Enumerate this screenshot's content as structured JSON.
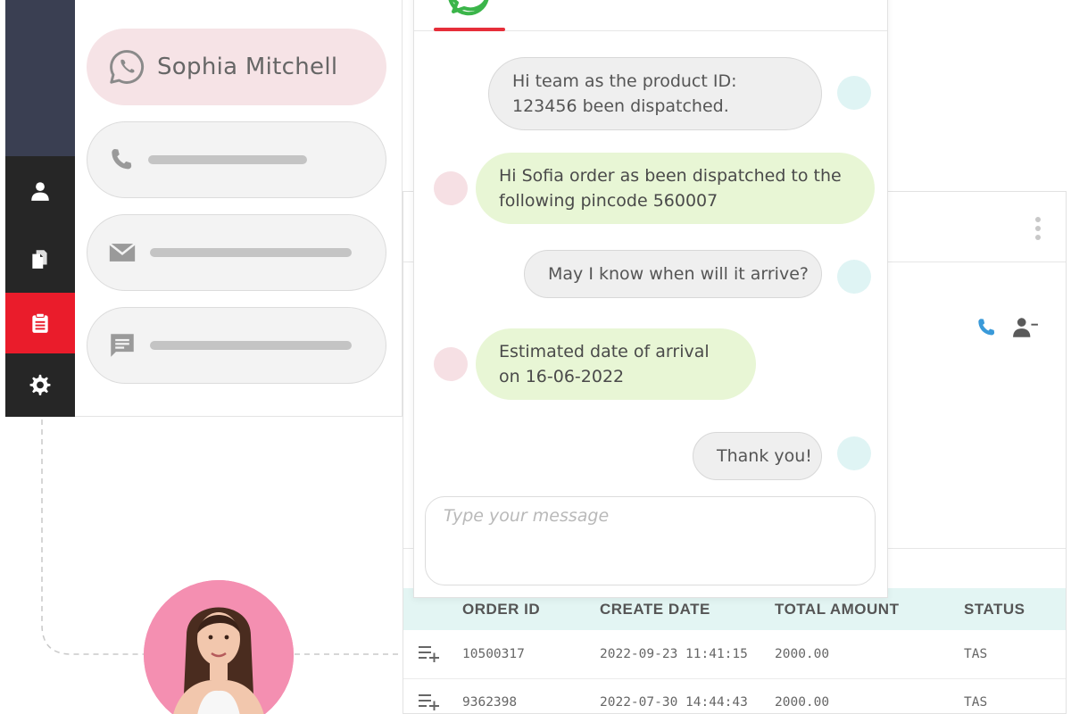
{
  "sidebar": {
    "items": [
      {
        "icon": "user-icon"
      },
      {
        "icon": "documents-icon"
      },
      {
        "icon": "clipboard-icon",
        "active": true
      },
      {
        "icon": "gear-icon"
      }
    ],
    "active_color": "#ea1c2b"
  },
  "contact": {
    "name": "Sophia Mitchell",
    "name_icon": "whatsapp-icon",
    "fields": [
      {
        "icon": "phone-icon"
      },
      {
        "icon": "mail-icon"
      },
      {
        "icon": "message-icon"
      }
    ]
  },
  "chat": {
    "brand_icon": "whatsapp-icon",
    "accent": "#e62e3a",
    "messages": [
      {
        "direction": "out",
        "text": "Hi team as the product ID: 123456 been dispatched."
      },
      {
        "direction": "in",
        "text": "Hi Sofia order as been dispatched to the following pincode 560007"
      },
      {
        "direction": "out",
        "text": "May I know when will it arrive?"
      },
      {
        "direction": "in",
        "text": "Estimated date of arrival on 16-06-2022"
      },
      {
        "direction": "out",
        "text": "Thank you!"
      }
    ],
    "composer": {
      "placeholder": "Type your message",
      "value": ""
    }
  },
  "orders": {
    "headers": [
      "ORDER ID",
      "CREATE DATE",
      "TOTAL AMOUNT",
      "STATUS"
    ],
    "rows": [
      {
        "order_id": "10500317",
        "create_date": "2022-09-23 11:41:15",
        "total_amount": "2000.00",
        "status": "TAS"
      },
      {
        "order_id": "9362398",
        "create_date": "2022-07-30 14:44:43",
        "total_amount": "2000.00",
        "status": "TAS"
      }
    ],
    "row_icon": "add-to-list-icon",
    "header_color": "#e3f5f3"
  },
  "quick_actions": {
    "call_icon": "phone-icon",
    "remove_user_icon": "user-minus-icon"
  }
}
